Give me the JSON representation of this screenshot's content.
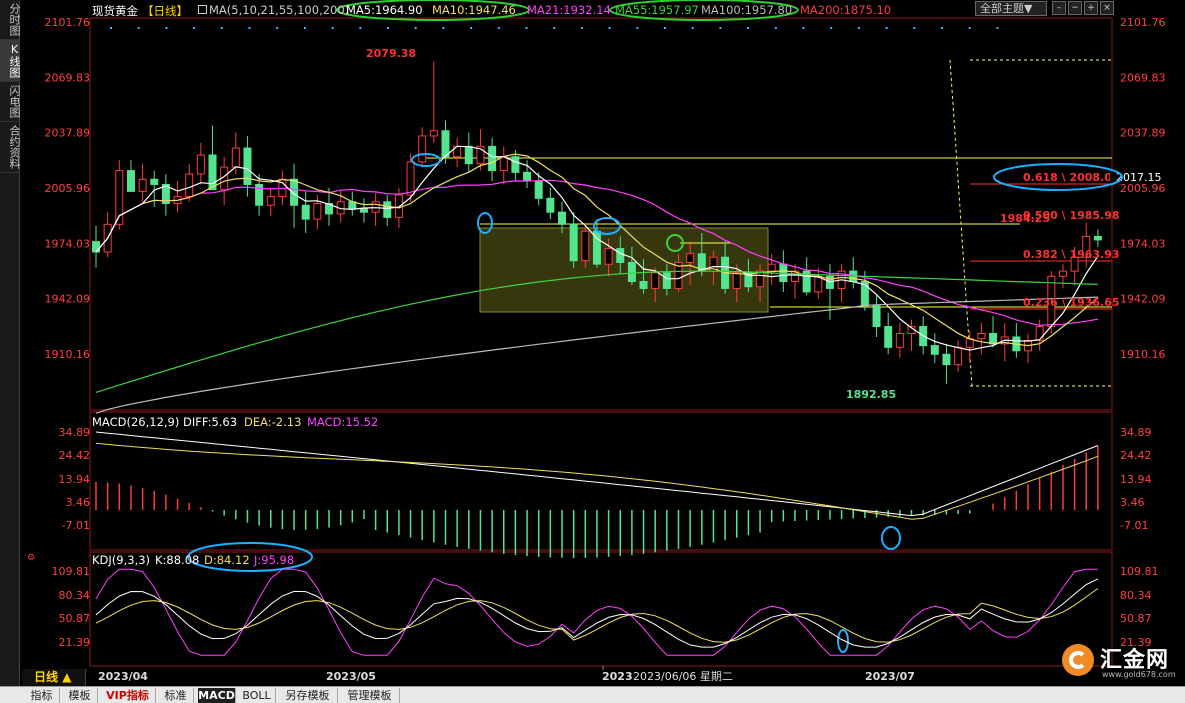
{
  "sidebar": {
    "items": [
      {
        "label": "分时图",
        "active": false
      },
      {
        "label": "K线图",
        "active": true
      },
      {
        "label": "闪电图",
        "active": false
      },
      {
        "label": "合约资料",
        "active": false
      }
    ]
  },
  "header": {
    "symbol": "现货黄金",
    "period": "【日线】",
    "ma_label": "MA(5,10,21,55,100,200)",
    "ma5": "MA5:1964.90",
    "ma10": "MA10:1947.46",
    "ma21": "MA21:1932.14",
    "ma55": "MA55:1957.97",
    "ma100": "MA100:1957.80",
    "ma200": "MA200:1875.10",
    "theme_select": "全部主题",
    "theme_arrow": "▼"
  },
  "colors": {
    "up": "#ff3b3b",
    "down": "#54e38e",
    "ma5": "#ffffff",
    "ma10": "#f0e05a",
    "ma21": "#ff40ff",
    "ma55": "#3fd23f",
    "ma100": "#bbbbbb",
    "label_red": "#ff3030",
    "fib": "#ffff40",
    "annot": "#1ab0ff",
    "axis": "#ff4040"
  },
  "fib_levels": [
    {
      "ratio": "0.618",
      "value": 2008.04,
      "label": "0.618 \\ 2008.04"
    },
    {
      "ratio": "0.500",
      "value": 1985.98,
      "label": "0.500 \\ 1985.98"
    },
    {
      "ratio": "0.382",
      "value": 1963.93,
      "label": "0.382 \\ 1963.93"
    },
    {
      "ratio": "0.236",
      "value": 1936.65,
      "label": "0.236 \\ 1936.65"
    }
  ],
  "price_labels": {
    "high": "2079.38",
    "low": "1892.85",
    "cursor": "2017.15",
    "last_partial": "1984.25"
  },
  "y_axis_main": [
    "2101.76",
    "2069.83",
    "2037.89",
    "2005.96",
    "1974.03",
    "1942.09",
    "1910.16"
  ],
  "macd": {
    "label": "MACD(26,12,9)",
    "diff": "DIFF:5.63",
    "dea": "DEA:-2.13",
    "macd": "MACD:15.52",
    "ticks": [
      "34.89",
      "24.42",
      "13.94",
      "3.46",
      "-7.01"
    ]
  },
  "kdj": {
    "label": "KDJ(9,3,3)",
    "k": "K:88.08",
    "d": "D:84.12",
    "j": "J:95.98",
    "ticks": [
      "109.81",
      "80.34",
      "50.87",
      "21.39"
    ]
  },
  "x_axis": [
    "2023/04",
    "2023/05",
    "2023/06",
    "2023/07"
  ],
  "crosshair_date": "2023/06/06 星期二",
  "period_tab": {
    "label": "日线",
    "arrow": "▲"
  },
  "bottom_tabs": [
    {
      "label": "指标",
      "active": false
    },
    {
      "label": "模板",
      "active": false
    },
    {
      "label": "VIP指标",
      "active": false
    },
    {
      "label": "标准",
      "active": false
    },
    {
      "label": "MACD",
      "active": true
    },
    {
      "label": "BOLL",
      "active": false
    },
    {
      "label": "另存模板",
      "active": false
    },
    {
      "label": "管理模板",
      "active": false
    }
  ],
  "logo": {
    "text": "汇金网",
    "url": "www.gold678.com"
  },
  "chart_data": {
    "type": "candlestick",
    "ohlc": [
      [
        1975,
        1984,
        1960,
        1969
      ],
      [
        1969,
        1992,
        1966,
        1985
      ],
      [
        1985,
        2022,
        1982,
        2016
      ],
      [
        2016,
        2022,
        2007,
        2004
      ],
      [
        2004,
        2020,
        1998,
        2011
      ],
      [
        2011,
        2016,
        1995,
        2008
      ],
      [
        2008,
        2014,
        1990,
        1997
      ],
      [
        1997,
        2010,
        1992,
        2001
      ],
      [
        2001,
        2020,
        1998,
        2014
      ],
      [
        2014,
        2032,
        2008,
        2025
      ],
      [
        2025,
        2042,
        2016,
        2005
      ],
      [
        2005,
        2024,
        1996,
        2018
      ],
      [
        2018,
        2038,
        2014,
        2029
      ],
      [
        2029,
        2036,
        2001,
        2008
      ],
      [
        2008,
        2014,
        1990,
        1996
      ],
      [
        1996,
        2006,
        1990,
        2001
      ],
      [
        2001,
        2016,
        1996,
        2011
      ],
      [
        2011,
        2020,
        1983,
        1996
      ],
      [
        1996,
        2004,
        1980,
        1988
      ],
      [
        1988,
        2002,
        1982,
        1997
      ],
      [
        1997,
        2006,
        1984,
        1991
      ],
      [
        1991,
        2005,
        1986,
        1998
      ],
      [
        1998,
        2004,
        1990,
        1994
      ],
      [
        1994,
        2000,
        1986,
        1992
      ],
      [
        1992,
        2003,
        1984,
        1998
      ],
      [
        1998,
        2002,
        1984,
        1989
      ],
      [
        1989,
        2006,
        1983,
        2002
      ],
      [
        2002,
        2026,
        1998,
        2021
      ],
      [
        2021,
        2041,
        2018,
        2036
      ],
      [
        2036,
        2079,
        2032,
        2039
      ],
      [
        2039,
        2045,
        2020,
        2024
      ],
      [
        2024,
        2035,
        2018,
        2030
      ],
      [
        2030,
        2038,
        2015,
        2020
      ],
      [
        2020,
        2040,
        2016,
        2030
      ],
      [
        2030,
        2035,
        2010,
        2016
      ],
      [
        2016,
        2030,
        2008,
        2024
      ],
      [
        2024,
        2028,
        2010,
        2015
      ],
      [
        2015,
        2022,
        2006,
        2010
      ],
      [
        2010,
        2015,
        1996,
        2000
      ],
      [
        2000,
        2006,
        1988,
        1992
      ],
      [
        1992,
        1998,
        1980,
        1985
      ],
      [
        1985,
        1992,
        1960,
        1964
      ],
      [
        1964,
        1986,
        1960,
        1981
      ],
      [
        1981,
        1988,
        1960,
        1962
      ],
      [
        1962,
        1977,
        1955,
        1971
      ],
      [
        1971,
        1978,
        1956,
        1963
      ],
      [
        1963,
        1972,
        1950,
        1952
      ],
      [
        1952,
        1965,
        1945,
        1948
      ],
      [
        1948,
        1960,
        1940,
        1957
      ],
      [
        1957,
        1962,
        1944,
        1948
      ],
      [
        1948,
        1968,
        1946,
        1963
      ],
      [
        1963,
        1974,
        1950,
        1968
      ],
      [
        1968,
        1980,
        1955,
        1958
      ],
      [
        1958,
        1970,
        1950,
        1966
      ],
      [
        1966,
        1975,
        1945,
        1948
      ],
      [
        1948,
        1962,
        1940,
        1957
      ],
      [
        1957,
        1965,
        1946,
        1949
      ],
      [
        1949,
        1962,
        1940,
        1958
      ],
      [
        1958,
        1968,
        1950,
        1962
      ],
      [
        1962,
        1970,
        1946,
        1952
      ],
      [
        1952,
        1962,
        1942,
        1958
      ],
      [
        1958,
        1966,
        1944,
        1946
      ],
      [
        1946,
        1960,
        1942,
        1955
      ],
      [
        1955,
        1962,
        1930,
        1948
      ],
      [
        1948,
        1962,
        1940,
        1958
      ],
      [
        1958,
        1966,
        1948,
        1952
      ],
      [
        1952,
        1958,
        1935,
        1938
      ],
      [
        1938,
        1944,
        1920,
        1926
      ],
      [
        1926,
        1934,
        1910,
        1914
      ],
      [
        1914,
        1928,
        1908,
        1922
      ],
      [
        1922,
        1930,
        1912,
        1926
      ],
      [
        1926,
        1932,
        1910,
        1915
      ],
      [
        1915,
        1922,
        1905,
        1910
      ],
      [
        1910,
        1916,
        1893,
        1904
      ],
      [
        1904,
        1918,
        1900,
        1914
      ],
      [
        1914,
        1924,
        1905,
        1919
      ],
      [
        1919,
        1928,
        1910,
        1922
      ],
      [
        1922,
        1932,
        1914,
        1916
      ],
      [
        1916,
        1928,
        1906,
        1920
      ],
      [
        1920,
        1928,
        1908,
        1912
      ],
      [
        1912,
        1922,
        1905,
        1918
      ],
      [
        1918,
        1930,
        1912,
        1926
      ],
      [
        1926,
        1958,
        1922,
        1955
      ],
      [
        1955,
        1962,
        1948,
        1958
      ],
      [
        1958,
        1972,
        1950,
        1966
      ],
      [
        1966,
        1986,
        1960,
        1978
      ],
      [
        1978,
        1982,
        1972,
        1976
      ]
    ]
  }
}
